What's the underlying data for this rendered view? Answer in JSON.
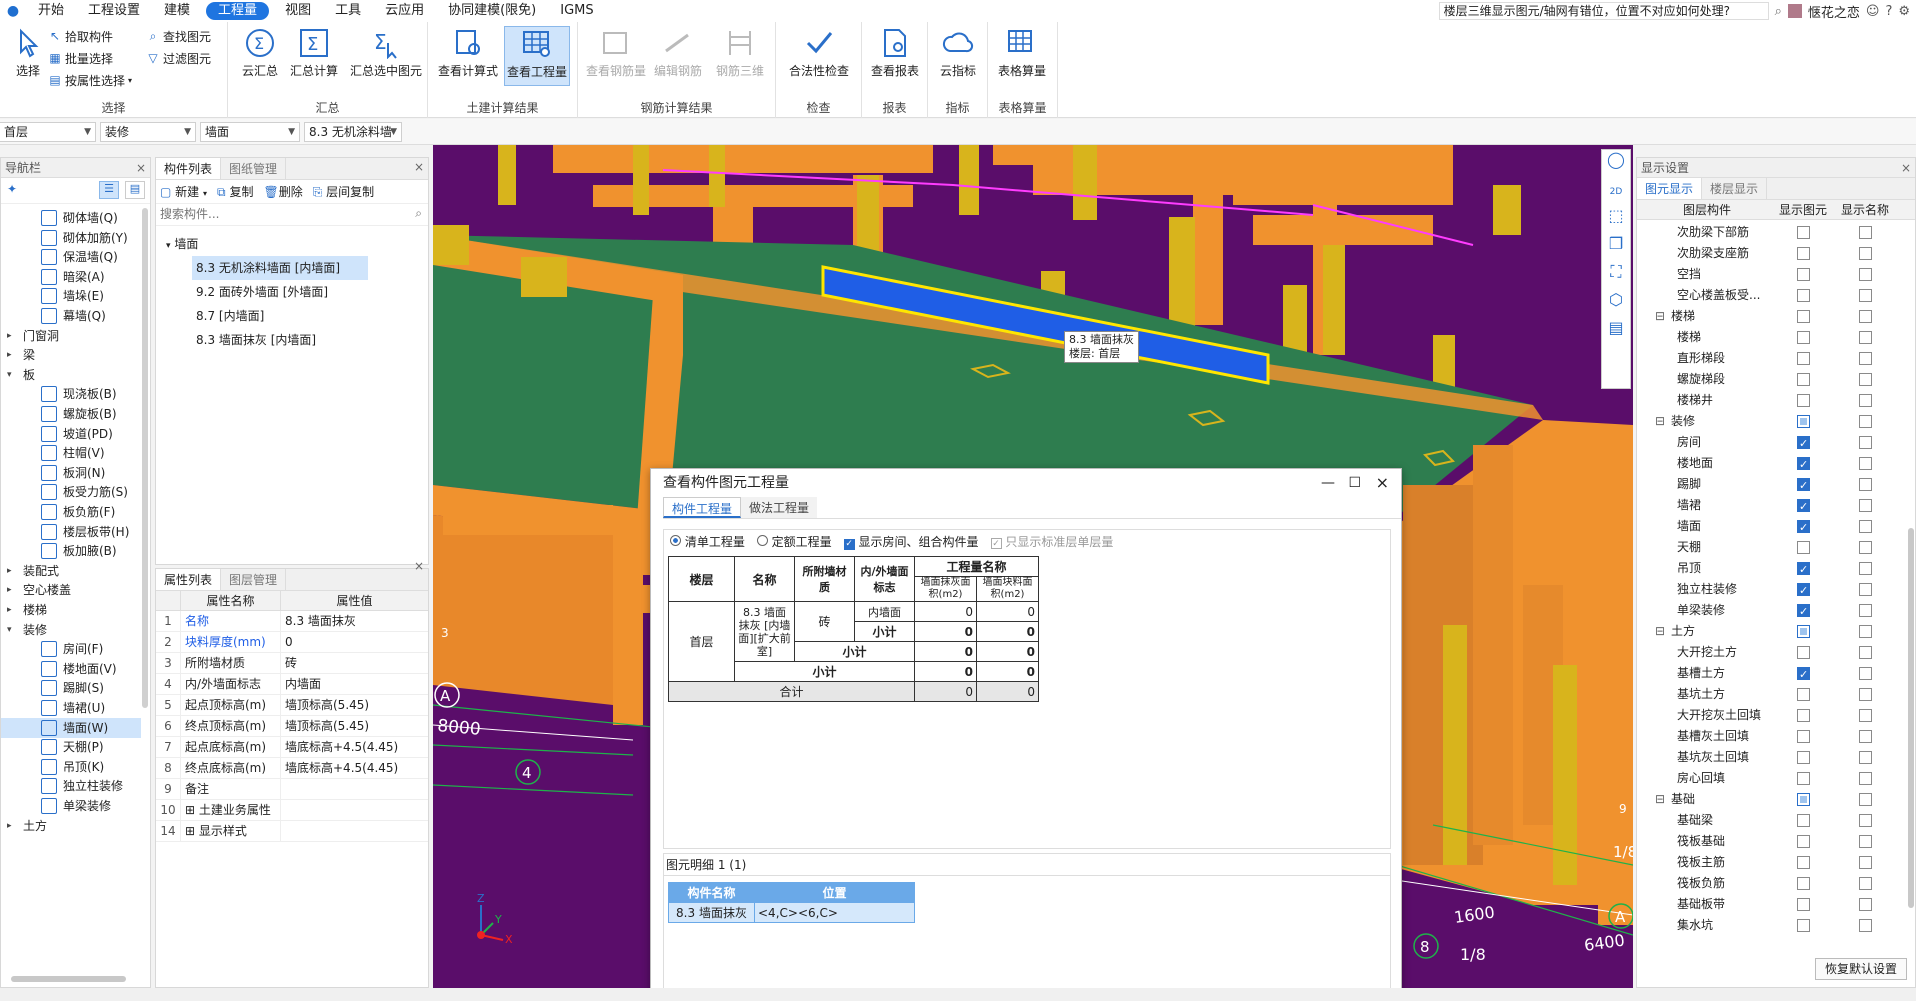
{
  "menu": {
    "items": [
      "开始",
      "工程设置",
      "建模",
      "工程量",
      "视图",
      "工具",
      "云应用",
      "协同建模(限免)",
      "IGMS"
    ],
    "active_index": 3,
    "search_text": "楼层三维显示图元/轴网有错位，位置不对应如何处理?",
    "user": "惬花之恋"
  },
  "ribbon": {
    "select_group": {
      "title": "选择",
      "big": "选择",
      "small": [
        "拾取构件",
        "批量选择",
        "按属性选择",
        "查找图元",
        "过滤图元"
      ]
    },
    "summary_group": {
      "title": "汇总",
      "buttons": [
        "云汇总",
        "汇总计算",
        "汇总选中图元"
      ]
    },
    "civil_group": {
      "title": "土建计算结果",
      "buttons": [
        "查看计算式",
        "查看工程量"
      ]
    },
    "rebar_group": {
      "title": "钢筋计算结果",
      "buttons": [
        "查看钢筋量",
        "编辑钢筋",
        "钢筋三维"
      ]
    },
    "check_group": {
      "title": "检查",
      "buttons": [
        "合法性检查"
      ]
    },
    "report_group": {
      "title": "报表",
      "buttons": [
        "查看报表"
      ]
    },
    "index_group": {
      "title": "指标",
      "buttons": [
        "云指标"
      ]
    },
    "table_group": {
      "title": "表格算量",
      "buttons": [
        "表格算量"
      ]
    }
  },
  "selectors": [
    "首层",
    "装修",
    "墙面",
    "8.3 无机涂料墙"
  ],
  "nav": {
    "title": "导航栏",
    "items": [
      {
        "label": "砌体墙(Q)",
        "type": "child"
      },
      {
        "label": "砌体加筋(Y)",
        "type": "child"
      },
      {
        "label": "保温墙(Q)",
        "type": "child"
      },
      {
        "label": "暗梁(A)",
        "type": "child"
      },
      {
        "label": "墙垛(E)",
        "type": "child"
      },
      {
        "label": "幕墙(Q)",
        "type": "child"
      },
      {
        "label": "门窗洞",
        "type": "group"
      },
      {
        "label": "梁",
        "type": "group"
      },
      {
        "label": "板",
        "type": "group-open"
      },
      {
        "label": "现浇板(B)",
        "type": "child"
      },
      {
        "label": "螺旋板(B)",
        "type": "child"
      },
      {
        "label": "坡道(PD)",
        "type": "child"
      },
      {
        "label": "柱帽(V)",
        "type": "child"
      },
      {
        "label": "板洞(N)",
        "type": "child"
      },
      {
        "label": "板受力筋(S)",
        "type": "child"
      },
      {
        "label": "板负筋(F)",
        "type": "child"
      },
      {
        "label": "楼层板带(H)",
        "type": "child"
      },
      {
        "label": "板加腋(B)",
        "type": "child"
      },
      {
        "label": "装配式",
        "type": "group"
      },
      {
        "label": "空心楼盖",
        "type": "group"
      },
      {
        "label": "楼梯",
        "type": "group"
      },
      {
        "label": "装修",
        "type": "group-open"
      },
      {
        "label": "房间(F)",
        "type": "child"
      },
      {
        "label": "楼地面(V)",
        "type": "child"
      },
      {
        "label": "踢脚(S)",
        "type": "child"
      },
      {
        "label": "墙裙(U)",
        "type": "child"
      },
      {
        "label": "墙面(W)",
        "type": "child-sel"
      },
      {
        "label": "天棚(P)",
        "type": "child"
      },
      {
        "label": "吊顶(K)",
        "type": "child"
      },
      {
        "label": "独立柱装修",
        "type": "child"
      },
      {
        "label": "单梁装修",
        "type": "child"
      },
      {
        "label": "土方",
        "type": "group"
      }
    ]
  },
  "components": {
    "tabs": [
      "构件列表",
      "图纸管理"
    ],
    "toolbar": [
      "新建",
      "复制",
      "删除",
      "层间复制"
    ],
    "search_placeholder": "搜索构件...",
    "root": "墙面",
    "items": [
      "8.3 无机涂料墙面 [内墙面]",
      "9.2 面砖外墙面 [外墙面]",
      "8.7 [内墙面]",
      "8.3 墙面抹灰 [内墙面]"
    ],
    "selected": 0
  },
  "properties": {
    "tabs": [
      "属性列表",
      "图层管理"
    ],
    "headers": [
      "属性名称",
      "属性值"
    ],
    "rows": [
      {
        "no": "1",
        "name": "名称",
        "value": "8.3 墙面抹灰",
        "link": true
      },
      {
        "no": "2",
        "name": "块料厚度(mm)",
        "value": "0",
        "link": true
      },
      {
        "no": "3",
        "name": "所附墙材质",
        "value": "砖",
        "link": false
      },
      {
        "no": "4",
        "name": "内/外墙面标志",
        "value": "内墙面",
        "link": false
      },
      {
        "no": "5",
        "name": "起点顶标高(m)",
        "value": "墙顶标高(5.45)",
        "link": false
      },
      {
        "no": "6",
        "name": "终点顶标高(m)",
        "value": "墙顶标高(5.45)",
        "link": false
      },
      {
        "no": "7",
        "name": "起点底标高(m)",
        "value": "墙底标高+4.5(4.45)",
        "link": false
      },
      {
        "no": "8",
        "name": "终点底标高(m)",
        "value": "墙底标高+4.5(4.45)",
        "link": false
      },
      {
        "no": "9",
        "name": "备注",
        "value": "",
        "link": false
      },
      {
        "no": "10",
        "name": "土建业务属性",
        "value": "",
        "link": false,
        "expand": true
      },
      {
        "no": "14",
        "name": "显示样式",
        "value": "",
        "link": false,
        "expand": true
      }
    ]
  },
  "viewport": {
    "tooltip": [
      "8.3 墙面抹灰",
      "楼层: 首层"
    ],
    "labels": {
      "axisA": "A",
      "dim8000": "8000",
      "axis4": "4",
      "axis8": "8",
      "frac18": "1/8",
      "dim1600": "1600",
      "dim6400": "6400",
      "axisA2": "A",
      "frac18b": "1/8",
      "c3": "3",
      "c9": "9"
    }
  },
  "dialog": {
    "title": "查看构件图元工程量",
    "tabs": [
      "构件工程量",
      "做法工程量"
    ],
    "options": [
      "清单工程量",
      "定额工程量",
      "显示房间、组合构件量",
      "只显示标准层单层量"
    ],
    "headers": {
      "floor": "楼层",
      "name": "名称",
      "material": "所附墙材质",
      "flag": "内/外墙面标志",
      "qty_name": "工程量名称",
      "plaster": "墙面抹灰面积(m2)",
      "block": "墙面块料面积(m2)"
    },
    "rows": {
      "floor": "首层",
      "name": "8.3 墙面抹灰 [内墙面][扩大前室]",
      "material": "砖",
      "inner": "内墙面",
      "subtotal": "小计",
      "total": "合计",
      "values": [
        "0",
        "0",
        "0",
        "0",
        "0",
        "0",
        "0",
        "0",
        "0",
        "0"
      ]
    },
    "detail_title": "图元明细 1 (1)",
    "detail_headers": [
      "构件名称",
      "位置"
    ],
    "detail_row": [
      "8.3 墙面抹灰",
      "<4,C><6,C>"
    ]
  },
  "display": {
    "title": "显示设置",
    "tabs": [
      "图元显示",
      "楼层显示"
    ],
    "headers": [
      "图层构件",
      "显示图元",
      "显示名称"
    ],
    "rows": [
      {
        "label": "次肋梁下部筋",
        "group": false,
        "show": false,
        "name": false
      },
      {
        "label": "次肋梁支座筋",
        "group": false,
        "show": false,
        "name": false
      },
      {
        "label": "空挡",
        "group": false,
        "show": false,
        "name": false
      },
      {
        "label": "空心楼盖板受...",
        "group": false,
        "show": false,
        "name": false
      },
      {
        "label": "楼梯",
        "group": true,
        "show": false,
        "name": false
      },
      {
        "label": "楼梯",
        "group": false,
        "show": false,
        "name": false
      },
      {
        "label": "直形梯段",
        "group": false,
        "show": false,
        "name": false
      },
      {
        "label": "螺旋梯段",
        "group": false,
        "show": false,
        "name": false
      },
      {
        "label": "楼梯井",
        "group": false,
        "show": false,
        "name": false
      },
      {
        "label": "装修",
        "group": true,
        "show": "partial",
        "name": false
      },
      {
        "label": "房间",
        "group": false,
        "show": true,
        "name": false
      },
      {
        "label": "楼地面",
        "group": false,
        "show": true,
        "name": false
      },
      {
        "label": "踢脚",
        "group": false,
        "show": true,
        "name": false
      },
      {
        "label": "墙裙",
        "group": false,
        "show": true,
        "name": false
      },
      {
        "label": "墙面",
        "group": false,
        "show": true,
        "name": false
      },
      {
        "label": "天棚",
        "group": false,
        "show": false,
        "name": false
      },
      {
        "label": "吊顶",
        "group": false,
        "show": true,
        "name": false
      },
      {
        "label": "独立柱装修",
        "group": false,
        "show": true,
        "name": false
      },
      {
        "label": "单梁装修",
        "group": false,
        "show": true,
        "name": false
      },
      {
        "label": "土方",
        "group": true,
        "show": "partial",
        "name": false
      },
      {
        "label": "大开挖土方",
        "group": false,
        "show": false,
        "name": false
      },
      {
        "label": "基槽土方",
        "group": false,
        "show": true,
        "name": false
      },
      {
        "label": "基坑土方",
        "group": false,
        "show": false,
        "name": false
      },
      {
        "label": "大开挖灰土回填",
        "group": false,
        "show": false,
        "name": false
      },
      {
        "label": "基槽灰土回填",
        "group": false,
        "show": false,
        "name": false
      },
      {
        "label": "基坑灰土回填",
        "group": false,
        "show": false,
        "name": false
      },
      {
        "label": "房心回填",
        "group": false,
        "show": false,
        "name": false
      },
      {
        "label": "基础",
        "group": true,
        "show": "partial",
        "name": false
      },
      {
        "label": "基础梁",
        "group": false,
        "show": false,
        "name": false
      },
      {
        "label": "筏板基础",
        "group": false,
        "show": false,
        "name": false
      },
      {
        "label": "筏板主筋",
        "group": false,
        "show": false,
        "name": false
      },
      {
        "label": "筏板负筋",
        "group": false,
        "show": false,
        "name": false
      },
      {
        "label": "基础板带",
        "group": false,
        "show": false,
        "name": false
      },
      {
        "label": "集水坑",
        "group": false,
        "show": false,
        "name": false
      }
    ],
    "reset_button": "恢复默认设置"
  },
  "colors": {
    "accent": "#1f75e0",
    "orange": "#f0922e",
    "yellow": "#d8b41c",
    "green": "#2e7d4f",
    "purple": "#5a0d6a",
    "blue": "#1f5ee6"
  }
}
